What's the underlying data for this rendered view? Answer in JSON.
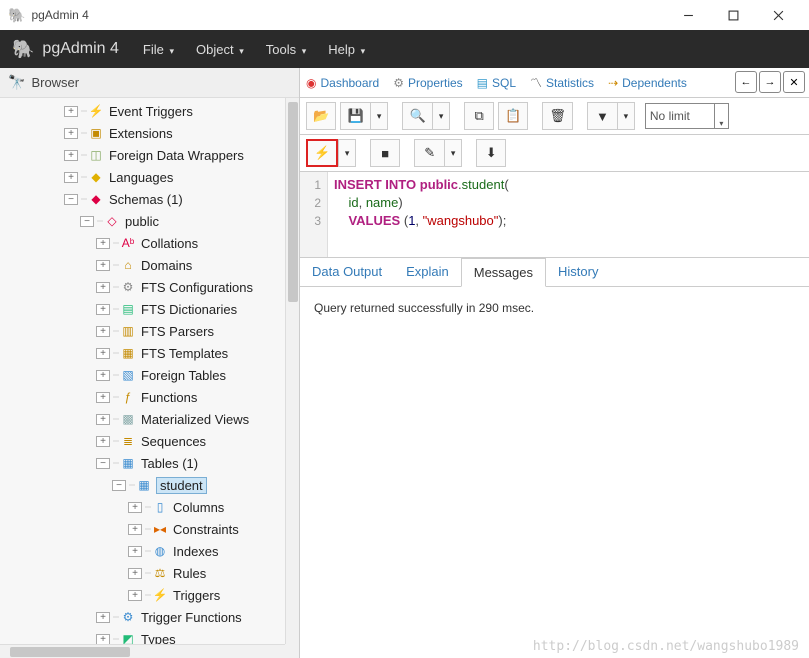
{
  "window": {
    "title": "pgAdmin 4"
  },
  "menubar": {
    "brand": "pgAdmin 4",
    "items": [
      "File",
      "Object",
      "Tools",
      "Help"
    ]
  },
  "browser": {
    "title": "Browser",
    "tree": [
      {
        "indent": 4,
        "exp": "+",
        "icon": "⚡",
        "iconColor": "#c48a00",
        "label": "Event Triggers"
      },
      {
        "indent": 4,
        "exp": "+",
        "icon": "▣",
        "iconColor": "#c48a00",
        "label": "Extensions"
      },
      {
        "indent": 4,
        "exp": "+",
        "icon": "◫",
        "iconColor": "#8a6",
        "label": "Foreign Data Wrappers"
      },
      {
        "indent": 4,
        "exp": "+",
        "icon": "◆",
        "iconColor": "#e0b000",
        "label": "Languages"
      },
      {
        "indent": 4,
        "exp": "−",
        "icon": "◆",
        "iconColor": "#d04",
        "label": "Schemas (1)"
      },
      {
        "indent": 5,
        "exp": "−",
        "icon": "◇",
        "iconColor": "#d04",
        "label": "public"
      },
      {
        "indent": 6,
        "exp": "+",
        "icon": "Aᵇ",
        "iconColor": "#d04",
        "label": "Collations"
      },
      {
        "indent": 6,
        "exp": "+",
        "icon": "⌂",
        "iconColor": "#c48a00",
        "label": "Domains"
      },
      {
        "indent": 6,
        "exp": "+",
        "icon": "⚙",
        "iconColor": "#888",
        "label": "FTS Configurations"
      },
      {
        "indent": 6,
        "exp": "+",
        "icon": "▤",
        "iconColor": "#2b7",
        "label": "FTS Dictionaries"
      },
      {
        "indent": 6,
        "exp": "+",
        "icon": "▥",
        "iconColor": "#c48a00",
        "label": "FTS Parsers"
      },
      {
        "indent": 6,
        "exp": "+",
        "icon": "▦",
        "iconColor": "#c48a00",
        "label": "FTS Templates"
      },
      {
        "indent": 6,
        "exp": "+",
        "icon": "▧",
        "iconColor": "#3a8bd0",
        "label": "Foreign Tables"
      },
      {
        "indent": 6,
        "exp": "+",
        "icon": "ƒ",
        "iconColor": "#c48a00",
        "label": "Functions"
      },
      {
        "indent": 6,
        "exp": "+",
        "icon": "▩",
        "iconColor": "#8aa",
        "label": "Materialized Views"
      },
      {
        "indent": 6,
        "exp": "+",
        "icon": "≣",
        "iconColor": "#c48a00",
        "label": "Sequences"
      },
      {
        "indent": 6,
        "exp": "−",
        "icon": "▦",
        "iconColor": "#3a8bd0",
        "label": "Tables (1)"
      },
      {
        "indent": 7,
        "exp": "−",
        "icon": "▦",
        "iconColor": "#3a8bd0",
        "label": "student",
        "selected": true
      },
      {
        "indent": 8,
        "exp": "+",
        "icon": "▯",
        "iconColor": "#3a8bd0",
        "label": "Columns"
      },
      {
        "indent": 8,
        "exp": "+",
        "icon": "▸◂",
        "iconColor": "#d60",
        "label": "Constraints"
      },
      {
        "indent": 8,
        "exp": "+",
        "icon": "◍",
        "iconColor": "#3a8bd0",
        "label": "Indexes"
      },
      {
        "indent": 8,
        "exp": "+",
        "icon": "⚖",
        "iconColor": "#c48a00",
        "label": "Rules"
      },
      {
        "indent": 8,
        "exp": "+",
        "icon": "⚡",
        "iconColor": "#3a8bd0",
        "label": "Triggers"
      },
      {
        "indent": 6,
        "exp": "+",
        "icon": "⚙",
        "iconColor": "#3a8bd0",
        "label": "Trigger Functions"
      },
      {
        "indent": 6,
        "exp": "+",
        "icon": "◩",
        "iconColor": "#2b7",
        "label": "Types"
      }
    ]
  },
  "tabs": {
    "items": [
      "Dashboard",
      "Properties",
      "SQL",
      "Statistics",
      "Dependents"
    ],
    "icons": [
      "◉",
      "⚙",
      "▤",
      "〽",
      "⇢"
    ]
  },
  "toolbar1": {
    "limit_value": "No limit"
  },
  "sql": {
    "lines": [
      "1",
      "2",
      "3"
    ],
    "l1": {
      "kw1": "INSERT",
      "kw2": "INTO",
      "kw3": "public",
      "dot": ".",
      "ident": "student",
      "open": "("
    },
    "l2": {
      "pad": "    ",
      "c1": "id",
      "comma": ", ",
      "c2": "name",
      "close": ")"
    },
    "l3": {
      "pad": "    ",
      "kw": "VALUES",
      "sp": " ",
      "open": "(",
      "v1": "1",
      "comma": ", ",
      "str": "\"wangshubo\"",
      "close": ");"
    }
  },
  "resultTabs": {
    "items": [
      "Data Output",
      "Explain",
      "Messages",
      "History"
    ],
    "activeIndex": 2
  },
  "messages": {
    "text": "Query returned successfully in 290 msec."
  },
  "watermark": "http://blog.csdn.net/wangshubo1989"
}
